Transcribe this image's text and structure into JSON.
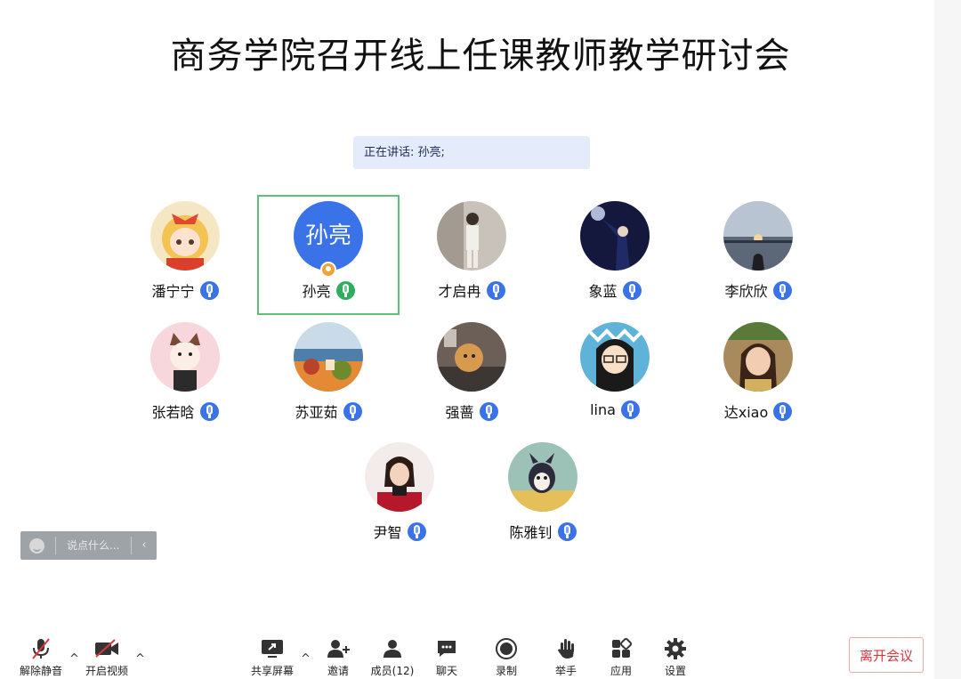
{
  "meeting": {
    "title": "商务学院召开线上任课教师教学研讨会",
    "speaking_label": "正在讲话: 孙亮;"
  },
  "participants": [
    {
      "name": "潘宁宁",
      "avatar": "cartoon-girl-avatar"
    },
    {
      "name": "孙亮",
      "avatar_text": "孙亮",
      "host": true,
      "speaking": true
    },
    {
      "name": "才启冉",
      "avatar": "person-photo-avatar"
    },
    {
      "name": "象蓝",
      "avatar": "night-photo-avatar"
    },
    {
      "name": "李欣欣",
      "avatar": "sunset-photo-avatar"
    },
    {
      "name": "张若晗",
      "avatar": "cat-drawing-avatar"
    },
    {
      "name": "苏亚茹",
      "avatar": "landscape-painting-avatar"
    },
    {
      "name": "强蔷",
      "avatar": "plush-toy-photo-avatar"
    },
    {
      "name": "lina",
      "avatar": "cartoon-glasses-avatar"
    },
    {
      "name": "达xiao",
      "avatar": "portrait-photo-avatar"
    },
    {
      "name": "尹智",
      "avatar": "woman-portrait-avatar"
    },
    {
      "name": "陈雅钊",
      "avatar": "cartoon-character-avatar"
    }
  ],
  "chat": {
    "placeholder": "说点什么..."
  },
  "toolbar": {
    "mute_label": "解除静音",
    "video_label": "开启视频",
    "share_label": "共享屏幕",
    "invite_label": "邀请",
    "members_label": "成员(12)",
    "chat_label": "聊天",
    "record_label": "录制",
    "raise_hand_label": "举手",
    "apps_label": "应用",
    "settings_label": "设置",
    "leave_label": "离开会议"
  },
  "colors": {
    "accent": "#3a72e8",
    "speaking_green": "#2fae5f",
    "leave_red": "#d9363e"
  }
}
